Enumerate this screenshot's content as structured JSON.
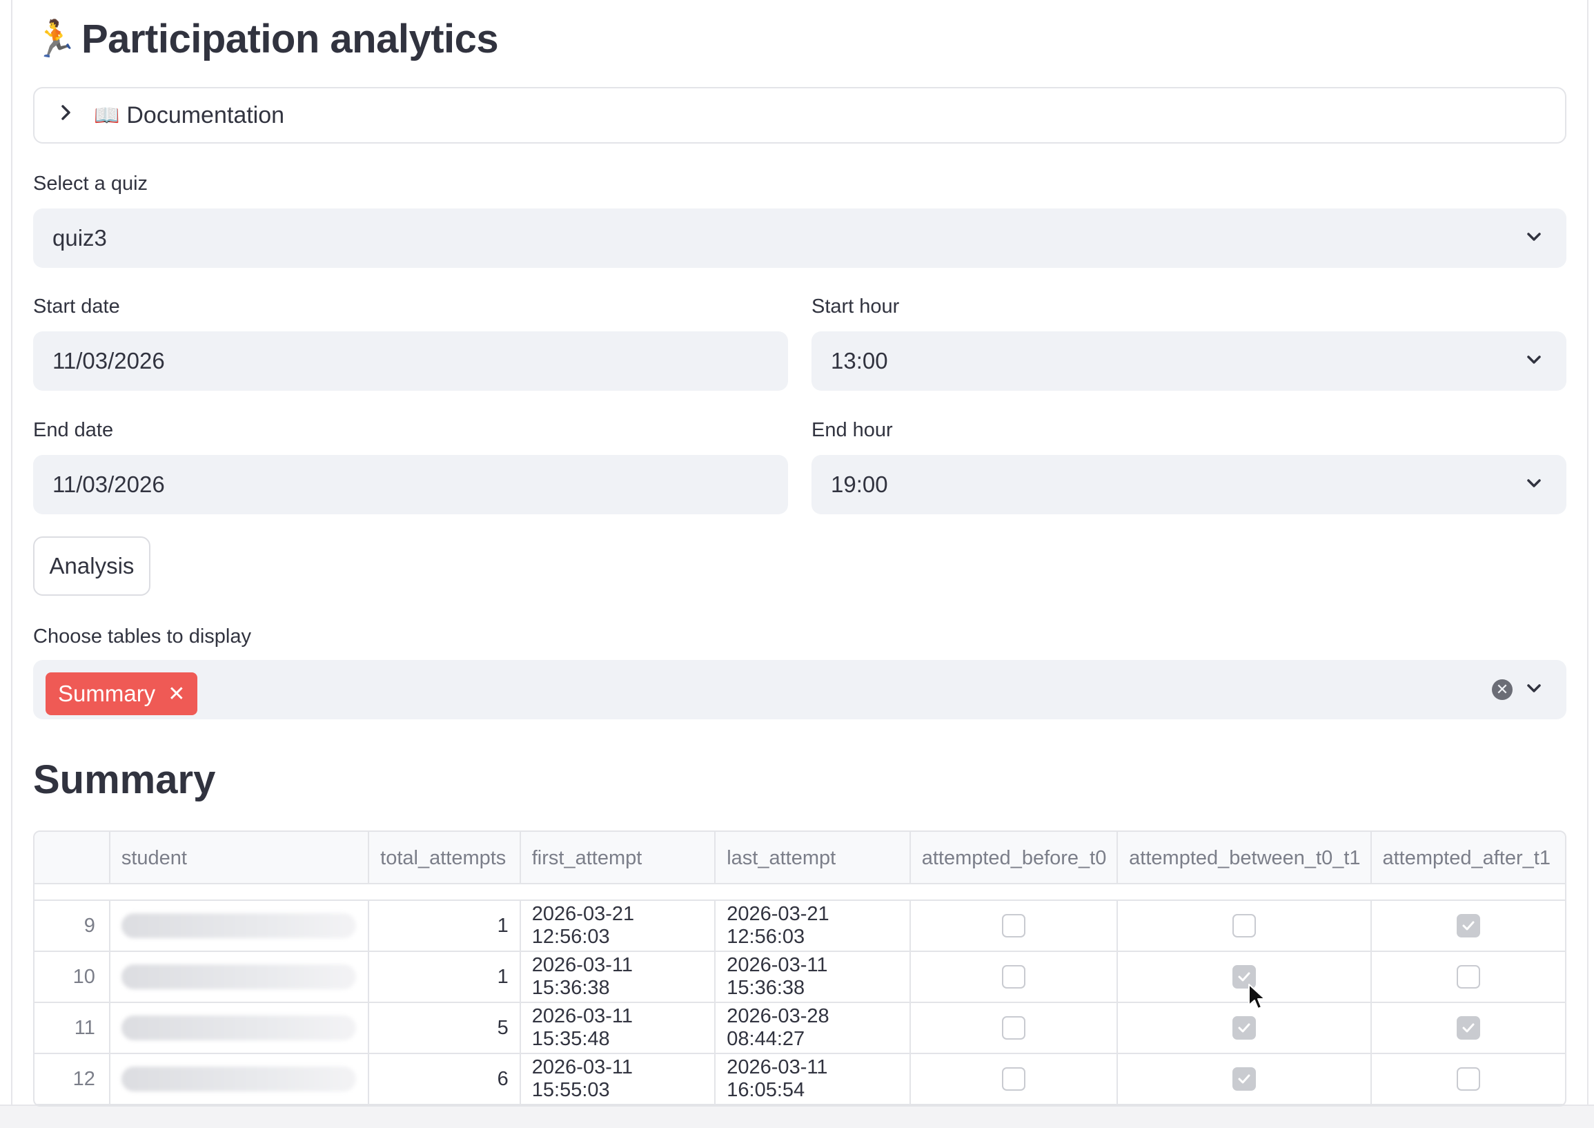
{
  "header": {
    "icon": "🏃",
    "title": "Participation analytics"
  },
  "documentation": {
    "icon": "📖",
    "label": "Documentation"
  },
  "quiz_select": {
    "label": "Select a quiz",
    "value": "quiz3"
  },
  "start_date": {
    "label": "Start date",
    "value": "11/03/2026"
  },
  "start_hour": {
    "label": "Start hour",
    "value": "13:00"
  },
  "end_date": {
    "label": "End date",
    "value": "11/03/2026"
  },
  "end_hour": {
    "label": "End hour",
    "value": "19:00"
  },
  "analysis_button": {
    "label": "Analysis"
  },
  "tables_select": {
    "label": "Choose tables to display",
    "tags": [
      "Summary"
    ],
    "tag_color": "#ef5a55"
  },
  "summary": {
    "title": "Summary",
    "columns": [
      "student",
      "total_attempts",
      "first_attempt",
      "last_attempt",
      "attempted_before_t0",
      "attempted_between_t0_t1",
      "attempted_after_t1"
    ],
    "rows": [
      {
        "index": "9",
        "total_attempts": "1",
        "first_attempt": "2026-03-21 12:56:03",
        "last_attempt": "2026-03-21 12:56:03",
        "before_t0": false,
        "between_t0_t1": false,
        "after_t1": true
      },
      {
        "index": "10",
        "total_attempts": "1",
        "first_attempt": "2026-03-11 15:36:38",
        "last_attempt": "2026-03-11 15:36:38",
        "before_t0": false,
        "between_t0_t1": true,
        "after_t1": false
      },
      {
        "index": "11",
        "total_attempts": "5",
        "first_attempt": "2026-03-11 15:35:48",
        "last_attempt": "2026-03-28 08:44:27",
        "before_t0": false,
        "between_t0_t1": true,
        "after_t1": true
      },
      {
        "index": "12",
        "total_attempts": "6",
        "first_attempt": "2026-03-11 15:55:03",
        "last_attempt": "2026-03-11 16:05:54",
        "before_t0": false,
        "between_t0_t1": true,
        "after_t1": false
      }
    ]
  }
}
